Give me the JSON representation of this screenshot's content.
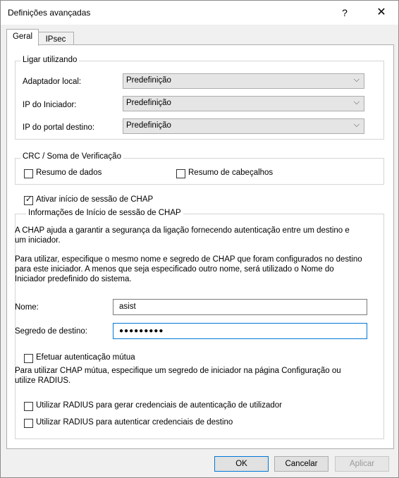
{
  "window": {
    "title": "Definições avançadas",
    "help": "?",
    "close": "✕"
  },
  "tabs": [
    {
      "label": "Geral"
    },
    {
      "label": "IPsec"
    }
  ],
  "connect": {
    "title": "Ligar utilizando",
    "rows": [
      {
        "label": "Adaptador local:",
        "value": "Predefinição"
      },
      {
        "label": "IP do Iniciador:",
        "value": "Predefinição"
      },
      {
        "label": "IP do portal destino:",
        "value": "Predefinição"
      }
    ]
  },
  "crc": {
    "title": "CRC / Soma de Verificação",
    "data_digest": "Resumo de dados",
    "header_digest": "Resumo de cabeçalhos"
  },
  "chap_enable": {
    "label": "Ativar início de sessão de CHAP",
    "checked": true
  },
  "chap": {
    "title": "Informações de Início de sessão de CHAP",
    "p1_l1": "A CHAP ajuda a garantir a segurança da ligação fornecendo autenticação entre um destino e",
    "p1_l2": "um iniciador.",
    "p2_l1": "Para utilizar, especifique o mesmo nome e segredo de CHAP que foram configurados no destino",
    "p2_l2": "para este iniciador. A menos que seja especificado outro nome, será utilizado o Nome do",
    "p2_l3": "Iniciador predefinido do sistema.",
    "name_label": "Nome:",
    "name_value": "asist",
    "secret_label": "Segredo de destino:",
    "secret_value": "●●●●●●●●●",
    "mutual_label": "Efetuar autenticação mútua",
    "p3_l1": "Para utilizar CHAP mútua, especifique um segredo de iniciador na página Configuração ou",
    "p3_l2": "utilize RADIUS.",
    "radius1": "Utilizar RADIUS para gerar credenciais de autenticação de utilizador",
    "radius2": "Utilizar RADIUS para autenticar credenciais de destino"
  },
  "buttons": {
    "ok": "OK",
    "cancel": "Cancelar",
    "apply": "Aplicar"
  },
  "icons": {
    "chevron": "chevron-down-icon",
    "check": "✓"
  }
}
